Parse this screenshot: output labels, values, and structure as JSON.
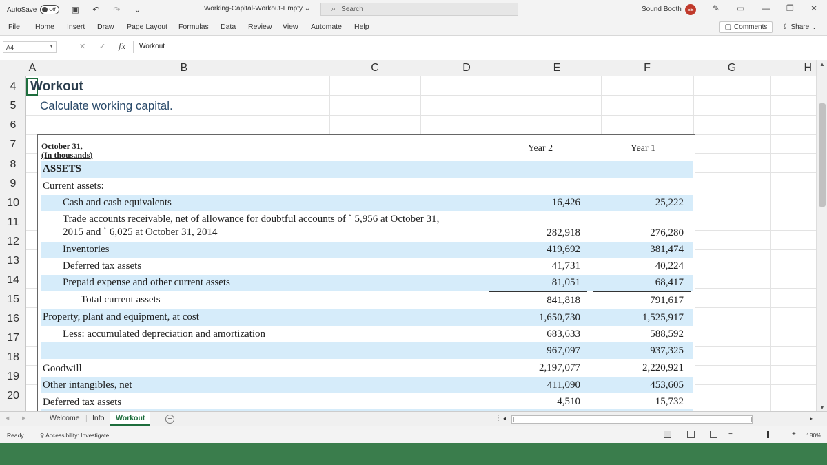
{
  "titlebar": {
    "autosave_label": "AutoSave",
    "autosave_state": "Off",
    "filename": "Working-Capital-Workout-Empty ⌄",
    "search_placeholder": "Search",
    "user_name": "Sound Booth",
    "user_initials": "SB"
  },
  "menu": {
    "items": [
      "File",
      "Home",
      "Insert",
      "Draw",
      "Page Layout",
      "Formulas",
      "Data",
      "Review",
      "View",
      "Automate",
      "Help"
    ],
    "comments_label": "Comments",
    "share_label": "Share"
  },
  "formula_bar": {
    "cell_ref": "A4",
    "fx": "fx",
    "content": "Workout"
  },
  "columns": [
    "A",
    "B",
    "C",
    "D",
    "E",
    "F",
    "G",
    "H"
  ],
  "rows": [
    "4",
    "5",
    "6",
    "7",
    "8",
    "9",
    "10",
    "11",
    "12",
    "13",
    "14",
    "15",
    "16",
    "17",
    "18",
    "19",
    "20"
  ],
  "sheet": {
    "title": "Workout",
    "subtitle": "Calculate working capital."
  },
  "financials": {
    "date_label": "October 31,",
    "units_label": "(In thousands)",
    "col_year2": "Year 2",
    "col_year1": "Year 1",
    "assets_header": "ASSETS",
    "current_assets_label": "Current assets:",
    "rows": [
      {
        "label": "Cash and cash equivalents",
        "y2": "16,426",
        "y1": "25,222"
      },
      {
        "label": "Trade accounts receivable, net of allowance for doubtful accounts of ` 5,956 at October 31,",
        "label2": "2015 and ` 6,025 at October 31, 2014",
        "y2": "282,918",
        "y1": "276,280"
      },
      {
        "label": "Inventories",
        "y2": "419,692",
        "y1": "381,474"
      },
      {
        "label": "Deferred tax assets",
        "y2": "41,731",
        "y1": "40,224"
      },
      {
        "label": "Prepaid expense and other current assets",
        "y2": "81,051",
        "y1": "68,417"
      },
      {
        "label": "Total current assets",
        "y2": "841,818",
        "y1": "791,617"
      },
      {
        "label": "Property, plant and equipment, at cost",
        "y2": "1,650,730",
        "y1": "1,525,917"
      },
      {
        "label": "Less: accumulated depreciation and amortization",
        "y2": "683,633",
        "y1": "588,592"
      },
      {
        "label": "",
        "y2": "967,097",
        "y1": "937,325"
      },
      {
        "label": "Goodwill",
        "y2": "2,197,077",
        "y1": "2,220,921"
      },
      {
        "label": "Other intangibles, net",
        "y2": "411,090",
        "y1": "453,605"
      },
      {
        "label": "Deferred tax assets",
        "y2": "4,510",
        "y1": "15,732"
      }
    ]
  },
  "tabs": {
    "items": [
      "Welcome",
      "Info",
      "Workout"
    ],
    "active": "Workout",
    "add_label": "+"
  },
  "status": {
    "ready": "Ready",
    "accessibility": "Accessibility: Investigate",
    "zoom": "180%"
  },
  "colors": {
    "excel_green": "#1e6e3d",
    "band_blue": "#d6ecfa",
    "avatar_red": "#c0392b"
  }
}
